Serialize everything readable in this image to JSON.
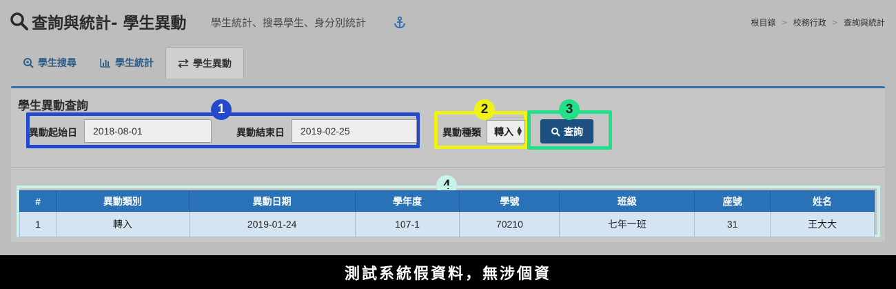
{
  "header": {
    "title": "查詢與統計- 學生異動",
    "subtitle": "學生統計、搜尋學生、身分別統計",
    "breadcrumb": [
      "根目錄",
      "校務行政",
      "查詢與統計"
    ]
  },
  "tabs": [
    {
      "label": "學生搜尋",
      "icon": "search-plus-icon",
      "active": false
    },
    {
      "label": "學生統計",
      "icon": "bar-chart-icon",
      "active": false
    },
    {
      "label": "學生異動",
      "icon": "exchange-icon",
      "active": true
    }
  ],
  "panel": {
    "title": "學生異動查詢",
    "start_date_label": "異動起始日",
    "start_date_value": "2018-08-01",
    "end_date_label": "異動結束日",
    "end_date_value": "2019-02-25",
    "type_label": "異動種類",
    "type_value": "轉入",
    "search_label": "查詢"
  },
  "badges": [
    "1",
    "2",
    "3",
    "4"
  ],
  "badge_colors": {
    "1": "#2449cc",
    "2": "#eef218",
    "3": "#22e08a",
    "4": "#c8f3ec"
  },
  "table": {
    "headers": [
      "#",
      "異動類別",
      "異動日期",
      "學年度",
      "學號",
      "班級",
      "座號",
      "姓名"
    ],
    "rows": [
      [
        "1",
        "轉入",
        "2019-01-24",
        "107-1",
        "70210",
        "七年一班",
        "31",
        "王大大"
      ]
    ]
  },
  "footer": {
    "text": "測試系統假資料，無涉個資"
  }
}
